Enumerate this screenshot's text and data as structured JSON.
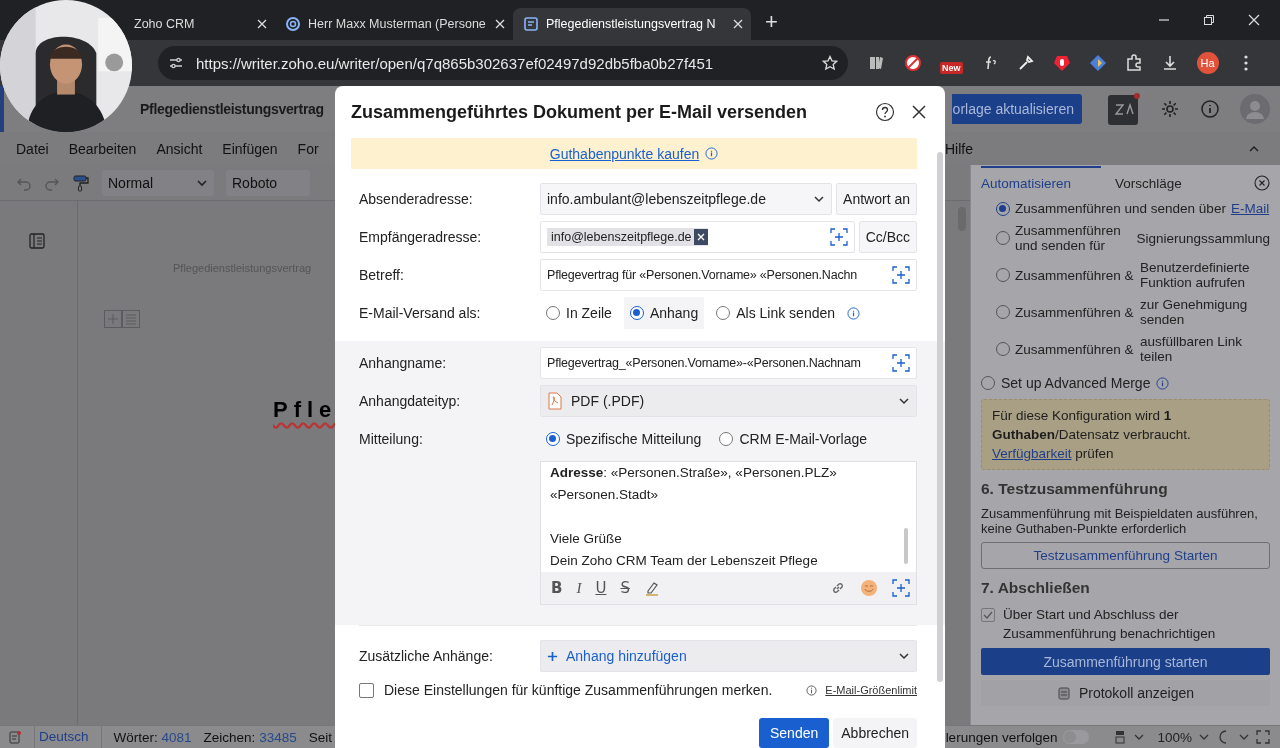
{
  "browser": {
    "tabs": [
      {
        "title": "Zoho CRM",
        "selected": false
      },
      {
        "title": "Herr Maxx Musterman (Persone",
        "selected": false
      },
      {
        "title": "Pflegedienstleistungsvertrag N",
        "selected": true
      }
    ],
    "new_tab": "+",
    "url": "https://writer.zoho.eu/writer/open/q7q865b302637ef02497d92db5fba0b27f451",
    "extension_badge": "New",
    "profile": "Ha"
  },
  "app_header": {
    "title": "Pflegedienstleistungsvertrag",
    "update_button": "orlage aktualisieren"
  },
  "menu": [
    "Datei",
    "Bearbeiten",
    "Ansicht",
    "Einfügen",
    "For",
    "Hilfe"
  ],
  "toolbar": {
    "style": "Normal",
    "font": "Roboto"
  },
  "document": {
    "header": "Pflegedienstleistungsvertrag",
    "title": "Pfle"
  },
  "panel": {
    "tabs": [
      {
        "label": "Automatisieren",
        "selected": true
      },
      {
        "label": "Vorschläge",
        "selected": false
      }
    ],
    "options": [
      {
        "kind": "inline",
        "label": "Zusammenführen und senden über",
        "link": "E-Mail",
        "selected": true
      },
      {
        "kind": "columns",
        "label": "Zusammenführen und senden für",
        "target": "Signierungssammlung",
        "selected": false
      },
      {
        "kind": "columns",
        "label": "Zusammenführen &",
        "target": "Benutzerdefinierte Funktion aufrufen",
        "selected": false
      },
      {
        "kind": "columns",
        "label": "Zusammenführen &",
        "target": "zur Genehmigung senden",
        "selected": false
      },
      {
        "kind": "columns",
        "label": "Zusammenführen &",
        "target": "ausfüllbaren Link teilen",
        "selected": false
      }
    ],
    "advanced": {
      "label": "Set up Advanced Merge",
      "selected": false
    },
    "note": {
      "text": "Für diese Konfiguration wird **1 Guthaben**/Datensatz verbraucht.",
      "link": "Verfügbarkeit",
      "suffix": "prüfen"
    },
    "test": {
      "heading": "6. Testzusammenführung",
      "text": "Zusammenführung mit Beispieldaten ausführen, keine Guthaben-Punkte erforderlich",
      "button": "Testzusammenführung Starten"
    },
    "finish": {
      "heading": "7. Abschließen",
      "notify": {
        "label": "Über Start und Abschluss der Zusammenführung benachrichtigen",
        "checked": true
      },
      "start_button": "Zusammenführung starten",
      "log_button": "Protokoll anzeigen"
    }
  },
  "status_bar": {
    "language": "Deutsch",
    "words_label": "Wörter:",
    "words": "4081",
    "chars_label": "Zeichen:",
    "chars": "33485",
    "page_label": "Seit",
    "track_changes": "lerungen verfolgen",
    "track_on": false,
    "zoom": "100%"
  },
  "dialog": {
    "title": "Zusammengeführtes Dokument per E-Mail versenden",
    "banner_link": "Guthabenpunkte kaufen",
    "sender": {
      "label": "Absenderadresse:",
      "value": "info.ambulant@lebenszeitpflege.de",
      "button": "Antwort an"
    },
    "recipient": {
      "label": "Empfängeradresse:",
      "chips": [
        "info@lebenszeitpflege.de"
      ],
      "button": "Cc/Bcc"
    },
    "subject": {
      "label": "Betreff:",
      "value": "Pflegevertrag für «Personen.Vorname» «Personen.Nachn"
    },
    "send_as": {
      "label": "E-Mail-Versand als:",
      "options": [
        {
          "label": "In Zeile",
          "selected": false
        },
        {
          "label": "Anhang",
          "selected": true
        },
        {
          "label": "Als Link senden",
          "selected": false
        }
      ]
    },
    "attachment_name": {
      "label": "Anhangname:",
      "value": "Pflegevertrag_«Personen.Vorname»-«Personen.Nachnam"
    },
    "file_type": {
      "label": "Anhangdateityp:",
      "value": "PDF (.PDF)"
    },
    "message": {
      "label": "Mitteilung:",
      "options": [
        {
          "label": "Spezifische Mitteilung",
          "selected": true
        },
        {
          "label": "CRM E-Mail-Vorlage",
          "selected": false
        }
      ],
      "body": [
        [
          "**Adresse**: «Personen.Straße», «Personen.PLZ»",
          "«Personen.Stadt»"
        ],
        [
          "Viele Grüße",
          "Dein Zoho CRM Team der Lebenszeit Pflege"
        ]
      ],
      "format_buttons": [
        "B",
        "I",
        "U",
        "S"
      ]
    },
    "extra": {
      "label": "Zusätzliche Anhänge:",
      "add": "Anhang hinzufügen"
    },
    "remember": {
      "label": "Diese Einstellungen für künftige Zusammenführungen merken.",
      "checked": false
    },
    "size_limit": "E-Mail-Größenlimit",
    "buttons": {
      "send": "Senden",
      "cancel": "Abbrechen"
    }
  }
}
